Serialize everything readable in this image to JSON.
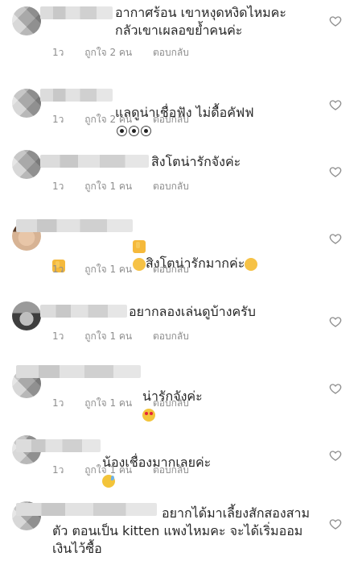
{
  "comments": [
    {
      "text": "อากาศร้อน เขาหงุดหงิดไหมคะ\nกลัวเขาเผลอขย้ำคนค่ะ",
      "time": "1ว",
      "likes": "ถูกใจ 2 คน",
      "reply": "ตอบกลับ"
    },
    {
      "text": "แลดูน่าเชื่อฟัง ไม่ดื้อคัฟฟ",
      "emoji": [
        "eyes-emoji",
        "eyes-emoji",
        "eyes-emoji"
      ],
      "time": "1ว",
      "likes": "ถูกใจ 2 คน",
      "reply": "ตอบกลับ"
    },
    {
      "text": "สิงโตน่ารักจังค่ะ",
      "time": "1ว",
      "likes": "ถูกใจ 1 คน",
      "reply": "ตอบกลับ"
    },
    {
      "text": "สิงโตน่ารักมากค่ะ",
      "emoji": [
        "thumbs-up-emoji",
        "clapping-hands-emoji",
        "clapping-hands-emoji",
        "thumbs-up-emoji"
      ],
      "time": "1ว",
      "likes": "ถูกใจ 1 คน",
      "reply": "ตอบกลับ"
    },
    {
      "text": "อยากลองเล่นดูบ้างครับ",
      "time": "1ว",
      "likes": "ถูกใจ 1 คน",
      "reply": "ตอบกลับ"
    },
    {
      "text": "น่ารักจังค่ะ",
      "emoji": [
        "heart-eyes-emoji"
      ],
      "time": "1ว",
      "likes": "ถูกใจ 1 คน",
      "reply": "ตอบกลับ"
    },
    {
      "text": "น้องเชื่องมากเลยค่ะ",
      "emoji": [
        "grinning-sweat-emoji"
      ],
      "time": "1ว",
      "likes": "ถูกใจ 1 คน",
      "reply": "ตอบกลับ"
    },
    {
      "text": "อยากได้มาเลี้ยงสักสองสาม\nตัว ตอนเป็น kitten แพงไหมคะ จะได้เริ่มออม\nเงินไว้ซื้อ",
      "time": "",
      "likes": "",
      "reply": ""
    }
  ],
  "icons": {
    "like": "heart-outline-icon"
  },
  "colors": {
    "text": "#262626",
    "meta": "#8e8e8e",
    "background": "#ffffff"
  }
}
